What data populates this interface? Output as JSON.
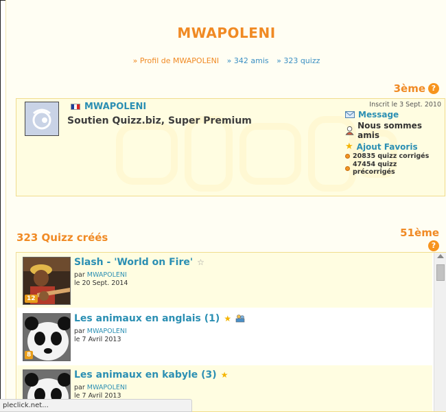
{
  "page": {
    "title": "MWAPOLENI",
    "nav": {
      "profile_link": "» Profil de MWAPOLENI",
      "friends_link": "» 342 amis",
      "quiz_link": "» 323 quizz"
    }
  },
  "profile": {
    "rank": "3ème",
    "username": "MWAPOLENI",
    "subtitle": "Soutien Quizz.biz, Super Premium",
    "since": "Inscrit le 3 Sept. 2010",
    "message_label": "Message",
    "friends_label": "Nous sommes amis",
    "favorite_label": "Ajout Favoris",
    "stat_corrected": "20835 quizz corrigés",
    "stat_precorrected": "47454 quizz précorrigés"
  },
  "quizzes": {
    "section_title": "323 Quizz créés",
    "rank": "51ème",
    "items": [
      {
        "title": "Slash - 'World on Fire'",
        "by": "par",
        "author": "MWAPOLENI",
        "date": "le 20 Sept. 2014",
        "badge": "12",
        "star": "outline"
      },
      {
        "title": "Les animaux en anglais (1)",
        "by": "par",
        "author": "MWAPOLENI",
        "date": "le 7 Avril 2013",
        "badge": "8",
        "star": "filled"
      },
      {
        "title": "Les animaux en kabyle (3)",
        "by": "par",
        "author": "MWAPOLENI",
        "date": "le 7 Avril 2013",
        "badge": "",
        "star": "filled"
      }
    ]
  },
  "status_bar": {
    "text": "pleclick.net..."
  },
  "icons": {
    "help": "question-mark-icon",
    "message": "envelope-icon",
    "friends": "user-icon",
    "favorite": "star-icon",
    "stat": "bullet-icon"
  },
  "colors": {
    "accent_orange": "#f08a24",
    "link_blue": "#2b8fb3",
    "panel_bg": "#fffde1"
  }
}
